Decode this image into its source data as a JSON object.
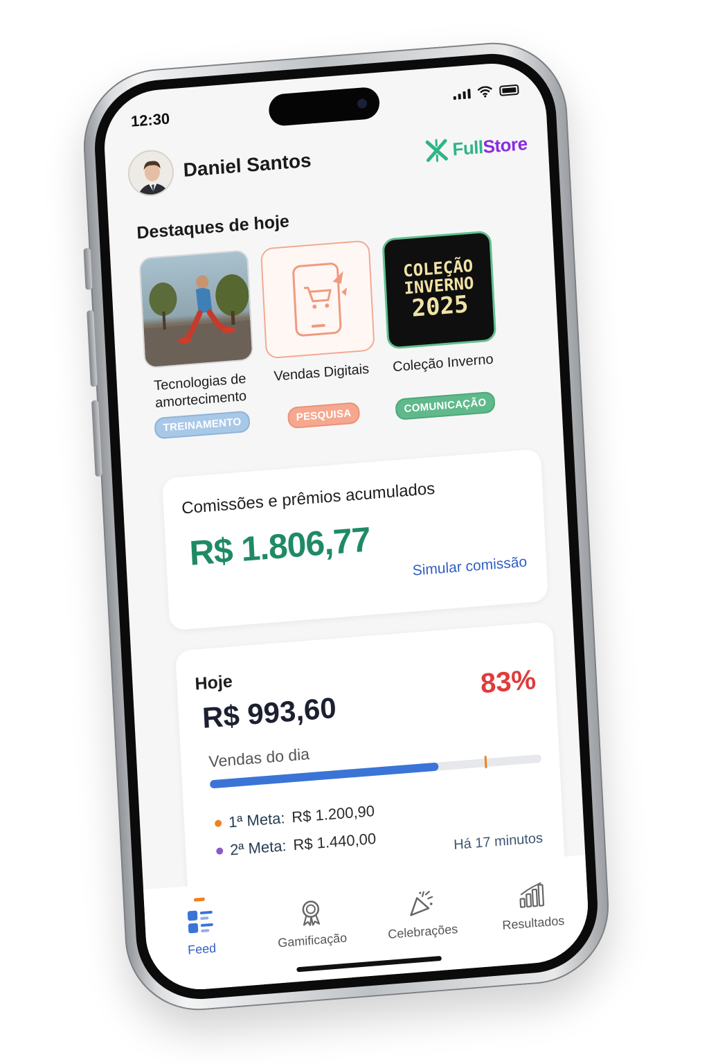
{
  "status_bar": {
    "time": "12:30"
  },
  "header": {
    "user_name": "Daniel Santos",
    "brand_name_part1": "Full",
    "brand_name_part2": "Store"
  },
  "highlights": {
    "title": "Destaques de hoje",
    "items": [
      {
        "label": "Tecnologias de amortecimento",
        "tag": "TREINAMENTO",
        "image_text": ""
      },
      {
        "label": "Vendas Digitais",
        "tag": "PESQUISA",
        "image_text": ""
      },
      {
        "label": "Coleção Inverno",
        "tag": "COMUNICAÇÃO",
        "image_text_line1": "COLEÇÃO",
        "image_text_line2": "INVERNO",
        "image_text_line3": "2025"
      }
    ]
  },
  "commissions": {
    "title": "Comissões e prêmios acumulados",
    "value": "R$ 1.806,77",
    "link": "Simular comissão"
  },
  "today": {
    "title": "Hoje",
    "value": "R$ 993,60",
    "percent_label": "83%",
    "progress": 0.69,
    "meta1_marker": 0.83,
    "sales_label": "Vendas do dia",
    "meta1_label": "1ª Meta:",
    "meta1_value": "R$ 1.200,90",
    "meta2_label": "2ª Meta:",
    "meta2_value": "R$ 1.440,00",
    "updated": "Há 17 minutos"
  },
  "tabbar": {
    "tabs": [
      {
        "label": "Feed",
        "icon": "feed-icon",
        "active": true
      },
      {
        "label": "Gamificação",
        "icon": "medal-icon",
        "active": false
      },
      {
        "label": "Celebrações",
        "icon": "party-popper-icon",
        "active": false
      },
      {
        "label": "Resultados",
        "icon": "bar-chart-icon",
        "active": false
      }
    ]
  },
  "colors": {
    "accent_green": "#1f8a64",
    "accent_blue": "#3a74d6",
    "percent_red": "#e03b3b",
    "meta1_orange": "#f0821e",
    "meta2_purple": "#8c5ac8"
  }
}
